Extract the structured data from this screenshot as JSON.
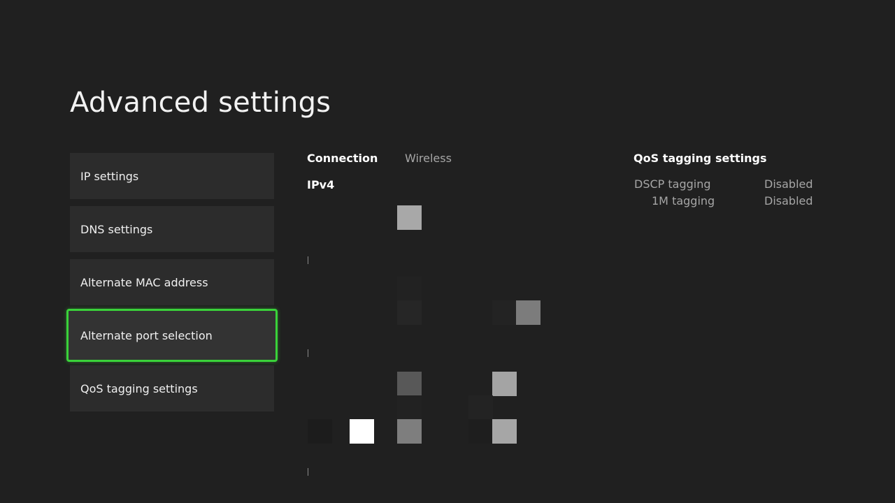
{
  "page": {
    "title": "Advanced settings"
  },
  "menu": {
    "items": [
      {
        "label": "IP settings"
      },
      {
        "label": "DNS settings"
      },
      {
        "label": "Alternate MAC address"
      },
      {
        "label": "Alternate port selection",
        "selected": true
      },
      {
        "label": "QoS tagging settings"
      }
    ],
    "selected_index": 3,
    "focus_color": "#3ad23a"
  },
  "connection": {
    "label": "Connection",
    "value": "Wireless",
    "protocol_label": "IPv4"
  },
  "qos": {
    "heading": "QoS tagging settings",
    "rows": [
      {
        "label": "DSCP tagging",
        "value": "Disabled"
      },
      {
        "label": "1M tagging",
        "value": "Disabled"
      }
    ]
  },
  "colors": {
    "background": "#202020",
    "menu_item": "#2c2c2c",
    "accent": "#3ad23a"
  }
}
